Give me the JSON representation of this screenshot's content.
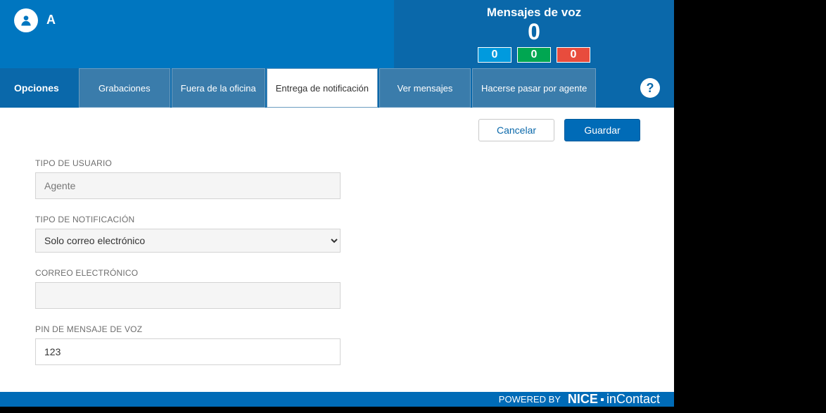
{
  "header": {
    "user_label": "A",
    "voicemail_title": "Mensajes de voz",
    "voicemail_count": "0",
    "badge_blue": "0",
    "badge_green": "0",
    "badge_red": "0"
  },
  "tabs": {
    "first": "Opciones",
    "items": [
      "Grabaciones",
      "Fuera de la oficina",
      "Entrega de notificación",
      "Ver mensajes",
      "Hacerse pasar por agente"
    ],
    "active_index": 2,
    "help": "?"
  },
  "actions": {
    "cancel": "Cancelar",
    "save": "Guardar"
  },
  "form": {
    "user_type_label": "TIPO DE USUARIO",
    "user_type_value": "Agente",
    "notification_type_label": "TIPO DE NOTIFICACIÓN",
    "notification_type_value": "Solo correo electrónico",
    "email_label": "CORREO ELECTRÓNICO",
    "email_value": "",
    "pin_label": "PIN DE MENSAJE DE VOZ",
    "pin_value": "123"
  },
  "footer": {
    "powered": "POWERED BY",
    "brand_nice": "NICE",
    "brand_in": "in",
    "brand_contact": "Contact"
  }
}
